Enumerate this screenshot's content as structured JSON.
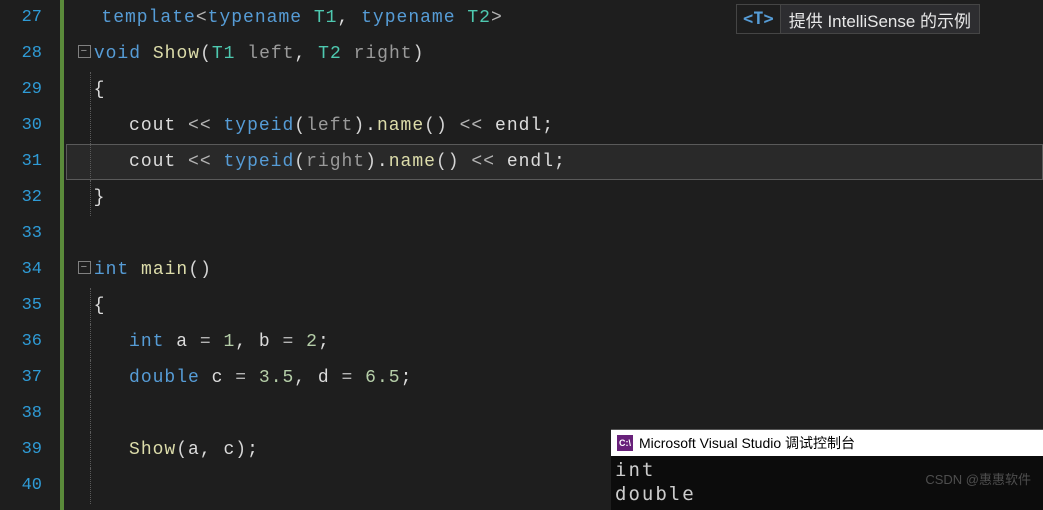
{
  "gutter": {
    "start": 27,
    "end": 40
  },
  "code": {
    "l27": {
      "template": "template",
      "open": "<",
      "tn1": "typename",
      "t1": "T1",
      "comma": ",",
      "tn2": "typename",
      "t2": "T2",
      "close": ">"
    },
    "l28": {
      "void": "void",
      "fn": "Show",
      "lp": "(",
      "t1": "T1",
      "p1": "left",
      "c": ",",
      "t2": "T2",
      "p2": "right",
      "rp": ")"
    },
    "l29": {
      "brace": "{"
    },
    "l30": {
      "cout": "cout",
      "op1": "<<",
      "typeid": "typeid",
      "lp": "(",
      "arg": "left",
      "rp": ")",
      "dot": ".",
      "name": "name",
      "lp2": "(",
      "rp2": ")",
      "op2": "<<",
      "endl": "endl",
      "semi": ";"
    },
    "l31": {
      "cout": "cout",
      "op1": "<<",
      "typeid": "typeid",
      "lp": "(",
      "arg": "right",
      "rp": ")",
      "dot": ".",
      "name": "name",
      "lp2": "(",
      "rp2": ")",
      "op2": "<<",
      "endl": "endl",
      "semi": ";"
    },
    "l32": {
      "brace": "}"
    },
    "l34": {
      "int": "int",
      "main": "main",
      "lp": "(",
      "rp": ")"
    },
    "l35": {
      "brace": "{"
    },
    "l36": {
      "int": "int",
      "a": "a",
      "eq1": "=",
      "v1": "1",
      "c1": ",",
      "b": "b",
      "eq2": "=",
      "v2": "2",
      "semi": ";"
    },
    "l37": {
      "double": "double",
      "c": "c",
      "eq1": "=",
      "v1": "3.5",
      "c1": ",",
      "d": "d",
      "eq2": "=",
      "v2": "6.5",
      "semi": ";"
    },
    "l39": {
      "fn": "Show",
      "lp": "(",
      "a1": "a",
      "c": ",",
      "a2": "c",
      "rp": ")",
      "semi": ";"
    }
  },
  "tooltip": {
    "icon": "<T>",
    "text": "提供 IntelliSense 的示例"
  },
  "console": {
    "title": "Microsoft Visual Studio 调试控制台",
    "lines": [
      "int",
      "double"
    ]
  },
  "watermark": "CSDN @惠惠软件"
}
